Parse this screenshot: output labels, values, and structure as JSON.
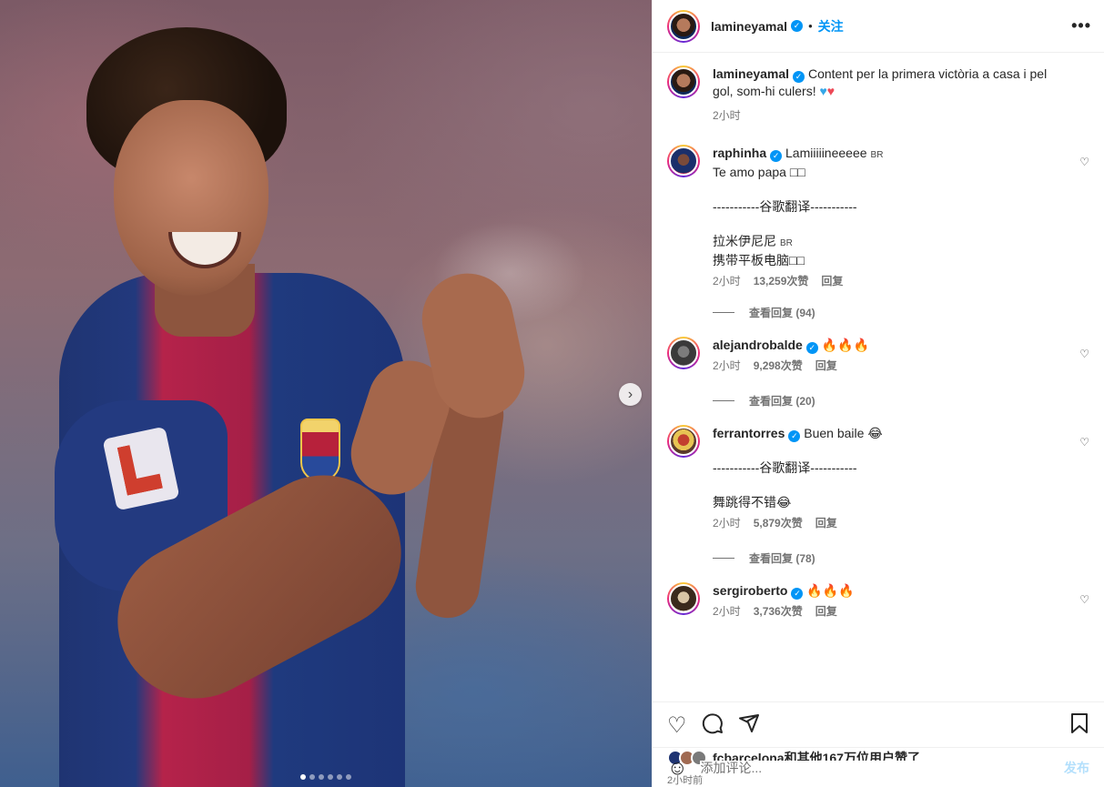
{
  "header": {
    "username": "lamineyamal",
    "separator": "•",
    "follow_label": "关注",
    "more_label": "•••"
  },
  "caption": {
    "username": "lamineyamal",
    "text": "Content per la primera victòria a casa i pel gol, som-hi culers!",
    "time": "2小时"
  },
  "comments": [
    {
      "username": "raphinha",
      "line1": "Lamiiiiineeeee",
      "tag": "BR",
      "line2": "Te amo papa",
      "line2_suffix": "□□",
      "translation_divider": "-----------谷歌翻译-----------",
      "translated1": "拉米伊尼尼",
      "translated_tag": "BR",
      "translated2": "携带平板电脑□□",
      "time": "2小时",
      "likes": "13,259次赞",
      "reply": "回复",
      "view_replies": "查看回复 (94)"
    },
    {
      "username": "alejandrobalde",
      "text": "🔥🔥🔥",
      "time": "2小时",
      "likes": "9,298次赞",
      "reply": "回复",
      "view_replies": "查看回复 (20)"
    },
    {
      "username": "ferrantorres",
      "text": "Buen baile 😂",
      "translation_divider": "-----------谷歌翻译-----------",
      "translated": "舞跳得不错😂",
      "time": "2小时",
      "likes": "5,879次赞",
      "reply": "回复",
      "view_replies": "查看回复 (78)"
    },
    {
      "username": "sergiroberto",
      "text": "🔥🔥🔥",
      "time": "2小时",
      "likes": "3,736次赞",
      "reply": "回复"
    }
  ],
  "likes": {
    "text_user": "fcbarcelona",
    "text_rest": "和其他167万位用户赞了"
  },
  "post_time": "2小时前",
  "add_comment": {
    "placeholder": "添加评论...",
    "post_label": "发布"
  },
  "colors": {
    "accent": "#0095f6",
    "muted": "#737373",
    "post_disabled": "#b2dffc"
  },
  "media": {
    "slide_count": 6,
    "active_slide": 1
  }
}
